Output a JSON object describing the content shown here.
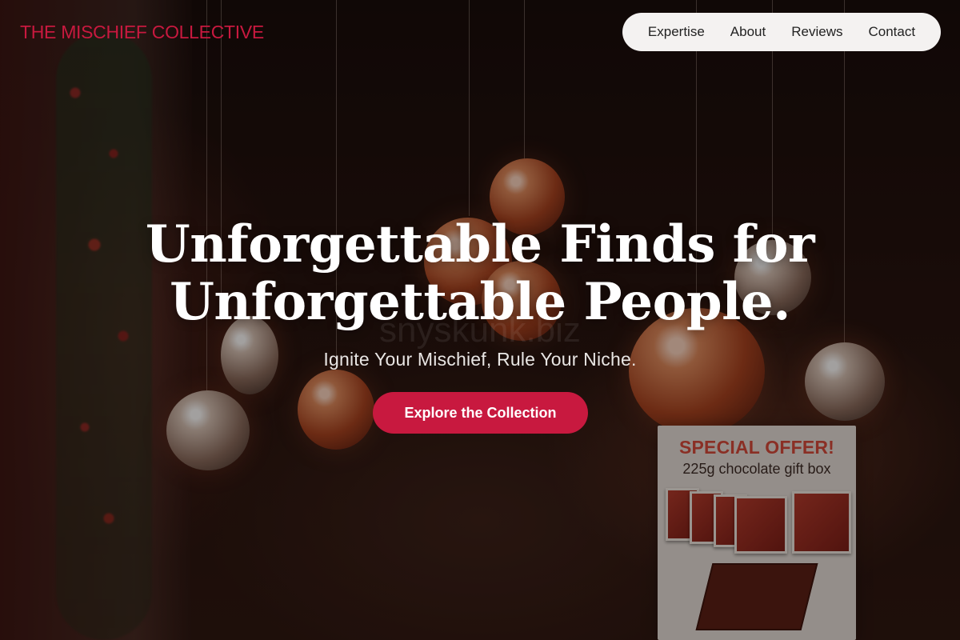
{
  "brand": {
    "name": "THE MISCHIEF COLLECTIVE"
  },
  "nav": {
    "items": [
      {
        "label": "Expertise"
      },
      {
        "label": "About"
      },
      {
        "label": "Reviews"
      },
      {
        "label": "Contact"
      }
    ]
  },
  "hero": {
    "headline_line1": "Unforgettable Finds for",
    "headline_line2": "Unforgettable People.",
    "tagline": "Ignite Your Mischief, Rule Your Niche.",
    "cta_label": "Explore the Collection",
    "watermark": "snyskunk.biz"
  },
  "background_sign": {
    "title": "SPECIAL OFFER!",
    "subtitle": "225g chocolate gift box"
  },
  "colors": {
    "accent": "#c8193f",
    "nav_bg": "#f4f2f1",
    "headline": "#ffffff"
  }
}
